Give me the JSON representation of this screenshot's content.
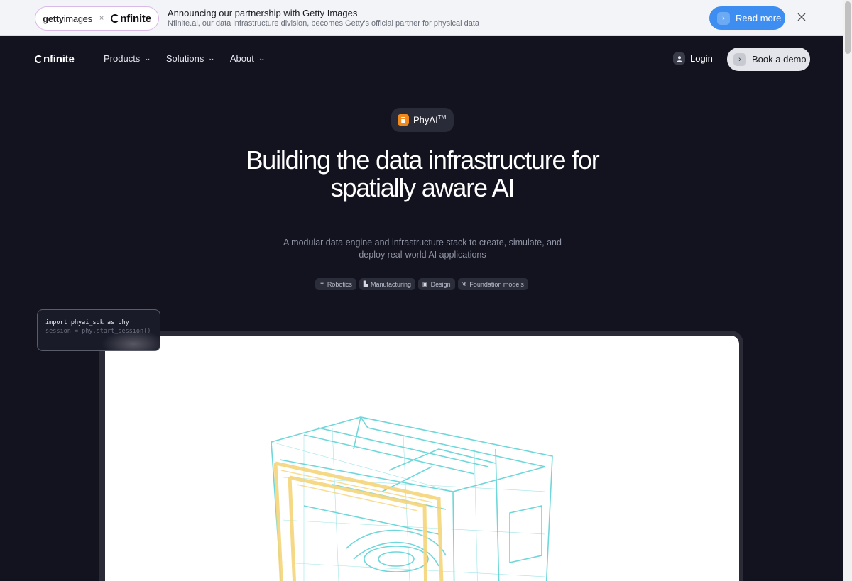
{
  "announcement": {
    "partner_logo_left": "getty",
    "partner_logo_left_suffix": "images",
    "times": "×",
    "partner_logo_right": "nfinite",
    "headline": "Announcing our partnership with Getty Images",
    "subline": "Nfinite.ai, our data infrastructure division, becomes Getty's official partner for physical data",
    "read_more_label": "Read more",
    "close_icon": "close-icon"
  },
  "nav": {
    "brand": "nfinite",
    "items": [
      {
        "label": "Products"
      },
      {
        "label": "Solutions"
      },
      {
        "label": "About"
      }
    ],
    "login_label": "Login",
    "demo_label": "Book a demo"
  },
  "hero": {
    "badge_label": "PhyAI",
    "badge_sup": "TM",
    "title": "Building the data infrastructure for spatially aware AI",
    "subtitle": "A modular data engine and infrastructure stack to create, simulate, and deploy real-world AI applications",
    "tags": [
      {
        "icon": "robot-icon",
        "glyph": "✝",
        "label": "Robotics"
      },
      {
        "icon": "factory-icon",
        "glyph": "▙",
        "label": "Manufacturing"
      },
      {
        "icon": "sofa-icon",
        "glyph": "▣",
        "label": "Design"
      },
      {
        "icon": "brain-icon",
        "glyph": "❦",
        "label": "Foundation models"
      }
    ]
  },
  "code": {
    "line1": "import phyai_sdk as phy",
    "line2": "session = phy.start_session()"
  },
  "colors": {
    "accent": "#3d8ef0",
    "background": "#12131f",
    "wireframe_teal": "#5fd3d6",
    "wireframe_yellow": "#f5d57a"
  }
}
